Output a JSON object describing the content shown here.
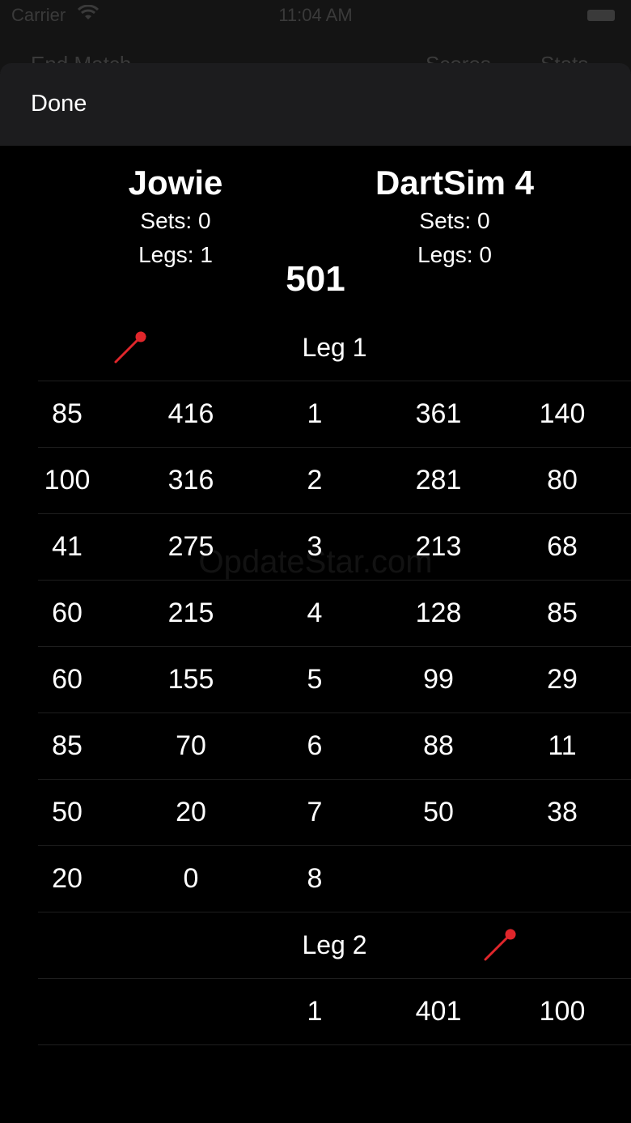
{
  "status_bar": {
    "carrier": "Carrier",
    "time": "11:04 AM"
  },
  "underlying_nav": {
    "end_match": "End Match",
    "scores": "Scores",
    "stats": "Stats"
  },
  "header": {
    "done_label": "Done"
  },
  "players": [
    {
      "name": "Jowie",
      "sets": "Sets: 0",
      "legs": "Legs: 1"
    },
    {
      "name": "DartSim 4",
      "sets": "Sets: 0",
      "legs": "Legs: 0"
    }
  ],
  "game_type": "501",
  "watermark": "OpdateStar.com",
  "legs": [
    {
      "label": "Leg 1",
      "starter": "left",
      "rows": [
        [
          "85",
          "416",
          "1",
          "361",
          "140"
        ],
        [
          "100",
          "316",
          "2",
          "281",
          "80"
        ],
        [
          "41",
          "275",
          "3",
          "213",
          "68"
        ],
        [
          "60",
          "215",
          "4",
          "128",
          "85"
        ],
        [
          "60",
          "155",
          "5",
          "99",
          "29"
        ],
        [
          "85",
          "70",
          "6",
          "88",
          "11"
        ],
        [
          "50",
          "20",
          "7",
          "50",
          "38"
        ],
        [
          "20",
          "0",
          "8",
          "",
          ""
        ]
      ]
    },
    {
      "label": "Leg 2",
      "starter": "right",
      "rows": [
        [
          "",
          "",
          "1",
          "401",
          "100"
        ]
      ]
    }
  ],
  "colors": {
    "background": "#000000",
    "header": "#1c1c1e",
    "dart": "#e0262b"
  },
  "icons": {
    "dart": "dart-icon"
  }
}
